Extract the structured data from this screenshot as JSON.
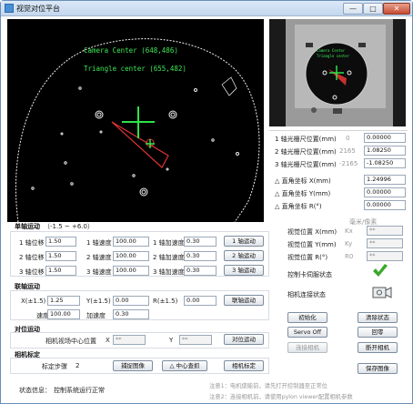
{
  "window": {
    "title": "视觉对位平台",
    "min": "—",
    "max": "□",
    "close": "✕"
  },
  "overlay": {
    "camera_center": "Camera Center (648,486)",
    "triangle_center": "Triangle center (655,482)"
  },
  "axis_info": {
    "rows": [
      {
        "label": "1 轴光栅尺位置(mm)",
        "raw": "0",
        "value": "0.00000"
      },
      {
        "label": "2 轴光栅尺位置(mm)",
        "raw": "2165",
        "value": "1.08250"
      },
      {
        "label": "3 轴光栅尺位置(mm)",
        "raw": "-2165",
        "value": "-1.08250"
      }
    ],
    "coords": [
      {
        "label": "△ 直角坐标 X(mm)",
        "value": "1.24996"
      },
      {
        "label": "△ 直角坐标 Y(mm)",
        "value": "0.00000"
      },
      {
        "label": "△ 直角坐标 R(°)",
        "value": "0.00000"
      }
    ]
  },
  "single_axis": {
    "title": "单轴运动",
    "range": "（-1.5 ~ +6.0）",
    "rows": [
      {
        "pos_label": "1 轴位移",
        "pos": "1.50",
        "spd_label": "1 轴速度",
        "spd": "100.00",
        "acc_label": "1 轴加速度",
        "acc": "0.30",
        "btn": "1 轴运动"
      },
      {
        "pos_label": "2 轴位移",
        "pos": "1.50",
        "spd_label": "2 轴速度",
        "spd": "100.00",
        "acc_label": "2 轴加速度",
        "acc": "0.30",
        "btn": "2 轴运动"
      },
      {
        "pos_label": "3 轴位移",
        "pos": "1.50",
        "spd_label": "3 轴速度",
        "spd": "100.00",
        "acc_label": "3 轴加速度",
        "acc": "0.30",
        "btn": "3 轴运动"
      }
    ]
  },
  "pixel": {
    "header": "毫米/像素",
    "rows": [
      {
        "label": "视觉位置 X(mm)",
        "unit": "Kx",
        "value": "**"
      },
      {
        "label": "视觉位置 Y(mm)",
        "unit": "Ky",
        "value": "**"
      },
      {
        "label": "视觉位置 R(°)",
        "unit": "R0",
        "value": "**"
      }
    ]
  },
  "linkage": {
    "title": "联轴运动",
    "x_label": "X(±1.5)",
    "x": "1.25",
    "y_label": "Y(±1.5)",
    "y": "0.00",
    "r_label": "R(±1.5)",
    "r": "0.00",
    "spd_label": "速度",
    "spd": "100.00",
    "acc_label": "加速度",
    "acc": "0.30",
    "btn": "联轴运动"
  },
  "status": {
    "controller": "控制卡伺服状态",
    "camera": "相机连接状态",
    "check_color": "#3aa82a"
  },
  "align": {
    "title": "对位运动",
    "label": "相机视场中心位置",
    "x_label": "X",
    "x": "**",
    "y_label": "Y",
    "y": "**",
    "btn": "对位运动"
  },
  "calib": {
    "title": "相机标定",
    "step_label": "标定步骤",
    "step": "2",
    "capture": "捕捉图像",
    "center": "△ 中心查抓",
    "calibrate": "相机标定"
  },
  "buttons": {
    "init": "初始化",
    "clear": "清除状态",
    "servo": "Servo Off",
    "home": "回零",
    "connect": "连接相机",
    "disconnect": "断开相机",
    "save": "保存图像"
  },
  "notes": {
    "n1": "注意1：电机使能前，请先打开控制器至正常位",
    "n2": "注意2：连接相机前，请使用pylon viewer配置相机参数"
  },
  "footer": {
    "label": "状态信息：",
    "text": "控制系统运行正常"
  }
}
